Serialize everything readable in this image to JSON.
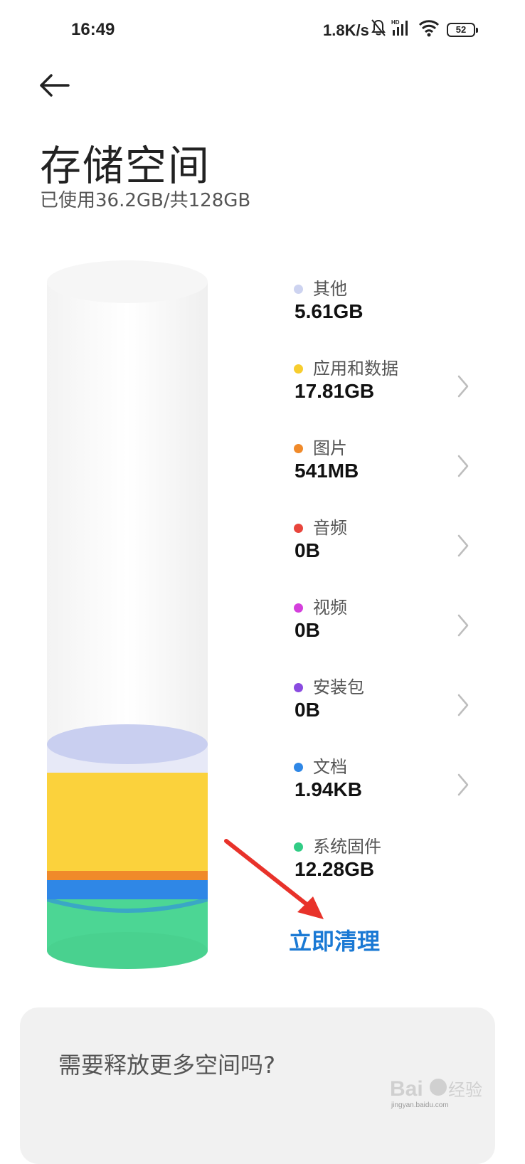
{
  "status_bar": {
    "time": "16:49",
    "network_speed": "1.8K/s",
    "battery": "52",
    "icons": [
      "mute-bell-icon",
      "hd-signal-icon",
      "wifi-icon",
      "battery-icon"
    ]
  },
  "header": {
    "back_icon": "back-arrow-icon",
    "title": "存储空间",
    "usage_summary": "已使用36.2GB/共128GB"
  },
  "storage": {
    "used_gb": 36.2,
    "total_gb": 128,
    "categories": [
      {
        "label": "其他",
        "value": "5.61GB",
        "color": "#cdd3f0",
        "has_chevron": false
      },
      {
        "label": "应用和数据",
        "value": "17.81GB",
        "color": "#f7cd2e",
        "has_chevron": true
      },
      {
        "label": "图片",
        "value": "541MB",
        "color": "#f08a2a",
        "has_chevron": true
      },
      {
        "label": "音频",
        "value": "0B",
        "color": "#e8453c",
        "has_chevron": true
      },
      {
        "label": "视频",
        "value": "0B",
        "color": "#d43fdc",
        "has_chevron": true
      },
      {
        "label": "安装包",
        "value": "0B",
        "color": "#8a4be0",
        "has_chevron": true
      },
      {
        "label": "文档",
        "value": "1.94KB",
        "color": "#2f87e6",
        "has_chevron": true
      },
      {
        "label": "系统固件",
        "value": "12.28GB",
        "color": "#31cc85",
        "has_chevron": false
      }
    ]
  },
  "actions": {
    "clean_now": "立即清理"
  },
  "more_space_card": {
    "text": "需要释放更多空间吗?"
  },
  "watermark": {
    "logo": "Bai du 经验",
    "url": "jingyan.baidu.com"
  }
}
